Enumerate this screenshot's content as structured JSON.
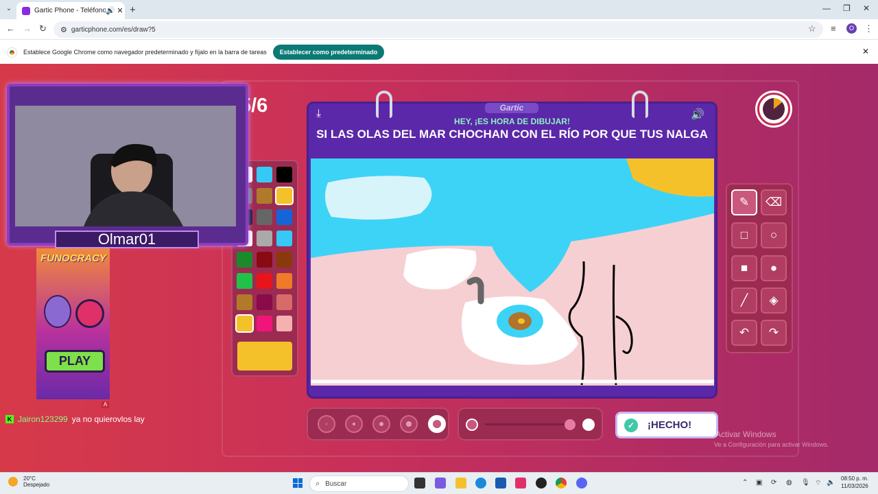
{
  "browser": {
    "tab_title": "Gartic Phone - Teléfono De",
    "url": "garticphone.com/es/draw?5",
    "infobar_text": "Establece Google Chrome como navegador predeterminado y fíjalo en la barra de tareas",
    "infobar_button": "Establecer como predeterminado",
    "profile_initial": "O"
  },
  "game": {
    "round": "5/6",
    "logo": "Gartic",
    "heading": "HEY, ¡ES HORA DE DIBUJAR!",
    "prompt": "SI LAS OLAS DEL MAR CHOCHAN CON EL RÍO POR QUE TUS NALGA",
    "done_button": "¡HECHO!",
    "palette_colors": [
      "#ffffff",
      "#36c9f5",
      "#000000",
      "#7a7a7a",
      "#b07a2a",
      "#f5c12a",
      "#1a1a3a",
      "#666666",
      "#1565d8",
      "#ffffff",
      "#aaaaaa",
      "#36c9f5",
      "#1a8a2a",
      "#8a0a12",
      "#8a3a0a",
      "#22c24a",
      "#e8141c",
      "#f07a2a",
      "#b07a2a",
      "#8a0a4a",
      "#d86a6a",
      "#f5c12a",
      "#f0157a",
      "#f5b0b0"
    ],
    "selected_color": "#f5c12a",
    "brush_sizes": 5,
    "selected_size": 5
  },
  "stream": {
    "streamer_name": "Olmar01",
    "ad_title": "FUNOCRACY",
    "ad_button": "PLAY",
    "ad_badge": "A",
    "chat_user": "Jairon123299",
    "chat_message": "ya no quierovlos lay"
  },
  "windows": {
    "watermark_title": "Activar Windows",
    "watermark_sub": "Ve a Configuración para activar Windows.",
    "weather_temp": "20°C",
    "weather_desc": "Despejado",
    "search_placeholder": "Buscar",
    "time": "08:50 p. m.",
    "date": "11/03/2026"
  }
}
